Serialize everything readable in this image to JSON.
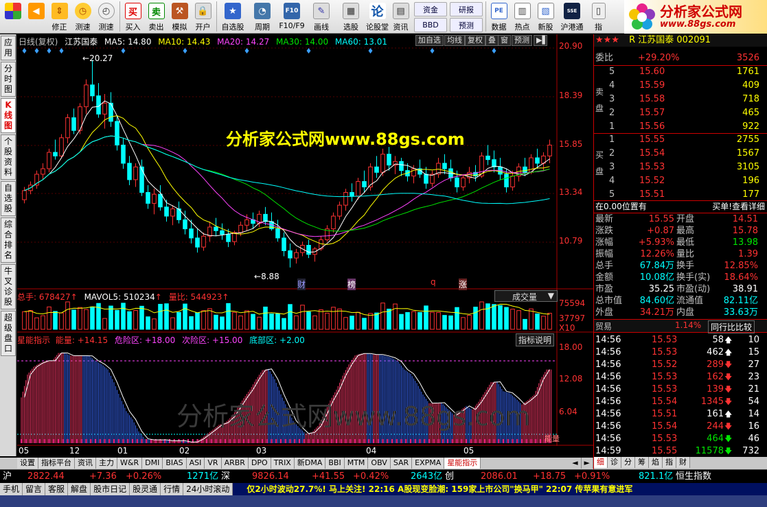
{
  "toolbar": {
    "buttons": [
      {
        "label": "",
        "icon": "window-icon"
      },
      {
        "label": "",
        "icon": "back-arrow-icon"
      },
      {
        "label": "修正",
        "icon": "up-down-icon"
      },
      {
        "label": "测速",
        "icon": "clock-icon"
      },
      {
        "label": "测速",
        "icon": "stopwatch-icon"
      },
      {
        "label": "买入",
        "icon": "buy-icon"
      },
      {
        "label": "卖出",
        "icon": "sell-icon"
      },
      {
        "label": "模拟",
        "icon": "hammer-icon"
      },
      {
        "label": "开户",
        "icon": "lock-icon"
      },
      {
        "label": "自选股",
        "icon": "star-icon"
      },
      {
        "label": "周期",
        "icon": "cycle-icon"
      },
      {
        "label": "F10/F9",
        "icon": "f10-icon"
      },
      {
        "label": "画线",
        "icon": "pen-icon"
      },
      {
        "label": "选股",
        "icon": "select-icon"
      },
      {
        "label": "论股堂",
        "icon": "forum-icon"
      },
      {
        "label": "资讯",
        "icon": "news-icon"
      }
    ],
    "small_buttons": [
      "资金",
      "研报",
      "BBD",
      "预测"
    ],
    "right_buttons": [
      {
        "label": "数据",
        "icon": "pe-icon"
      },
      {
        "label": "热点",
        "icon": "hotspot-icon"
      },
      {
        "label": "新股",
        "icon": "newstock-icon"
      },
      {
        "label": "沪港通",
        "icon": "sse-hkex-icon"
      },
      {
        "label": "指",
        "icon": "index-icon"
      }
    ],
    "logo_title": "分析家公式网",
    "logo_url": "www.88gs.com"
  },
  "left_tabs": [
    "应用",
    "分时图",
    "K线图",
    "个股资料",
    "自选股",
    "综合排名",
    "牛叉诊股",
    "超级盘口"
  ],
  "chart_header": {
    "period": "日线(复权)",
    "stock_name": "江苏国泰",
    "ma5": "MA5: 14.80",
    "ma10": "MA10: 14.43",
    "ma20": "MA20: 14.27",
    "ma30": "MA30: 14.00",
    "ma60": "MA60: 13.01",
    "buttons": [
      "加自选",
      "均线",
      "复权",
      "叠",
      "窗",
      "预测"
    ]
  },
  "watermark_top": "分析家公式网www.88gs.com",
  "watermark_bottom": "分析家公式网www.88gs.com",
  "chart_data": {
    "type": "candlestick",
    "price_axis_ticks": [
      "20.90",
      "18.39",
      "15.85",
      "13.34",
      "10.79"
    ],
    "price_range": [
      8.5,
      21.0
    ],
    "high_label": "20.27",
    "low_label": "8.88",
    "event_labels": [
      "财",
      "榜",
      "q",
      "涨"
    ],
    "volume": {
      "total": "总手: 678427",
      "mavol5": "MAVOL5: 510234",
      "volume_ratio": "量比: 544923",
      "axis_ticks": [
        "75594",
        "37797",
        "X10"
      ],
      "dropdown": "成交量"
    },
    "indicator": {
      "name": "星能指示",
      "energy": "能量: +14.15",
      "danger": "危险区: +18.00",
      "second": "次险区: +15.00",
      "bottom": "底部区: +2.00",
      "help": "指标说明",
      "axis_ticks": [
        "18.00",
        "12.08",
        "6.04"
      ],
      "end_label": "能量"
    },
    "time_axis": [
      "05",
      "12",
      "01",
      "02",
      "03",
      "04",
      "05"
    ],
    "candles": [
      [
        12.6,
        13.3,
        12.4,
        13.1
      ],
      [
        13.1,
        13.6,
        12.9,
        13.4
      ],
      [
        13.4,
        14.2,
        13.2,
        14.0
      ],
      [
        14.0,
        14.6,
        13.7,
        14.3
      ],
      [
        14.3,
        15.4,
        14.1,
        15.2
      ],
      [
        15.2,
        15.9,
        14.8,
        15.0
      ],
      [
        15.0,
        16.2,
        14.9,
        16.0
      ],
      [
        16.0,
        17.3,
        15.7,
        17.1
      ],
      [
        17.1,
        17.6,
        16.2,
        16.4
      ],
      [
        16.4,
        17.9,
        16.2,
        17.7
      ],
      [
        17.7,
        19.2,
        17.3,
        18.9
      ],
      [
        18.9,
        20.27,
        18.0,
        18.3
      ],
      [
        18.3,
        19.0,
        17.1,
        17.3
      ],
      [
        17.3,
        18.4,
        16.5,
        17.9
      ],
      [
        17.9,
        18.5,
        16.6,
        16.9
      ],
      [
        16.9,
        17.2,
        15.3,
        15.6
      ],
      [
        15.6,
        16.0,
        14.3,
        14.6
      ],
      [
        14.6,
        15.0,
        13.4,
        13.7
      ],
      [
        13.7,
        14.6,
        13.3,
        14.4
      ],
      [
        14.4,
        14.8,
        12.8,
        13.0
      ],
      [
        13.0,
        13.4,
        12.1,
        12.4
      ],
      [
        12.4,
        13.2,
        11.8,
        12.9
      ],
      [
        12.9,
        13.4,
        12.0,
        12.2
      ],
      [
        12.2,
        12.6,
        11.4,
        11.7
      ],
      [
        11.7,
        12.3,
        11.2,
        12.1
      ],
      [
        12.1,
        12.5,
        11.3,
        11.5
      ],
      [
        11.5,
        12.0,
        10.7,
        11.0
      ],
      [
        11.0,
        11.5,
        10.2,
        10.5
      ],
      [
        10.5,
        11.0,
        9.7,
        10.0
      ],
      [
        10.0,
        10.8,
        9.8,
        10.6
      ],
      [
        10.6,
        11.4,
        10.3,
        11.1
      ],
      [
        11.1,
        11.6,
        10.6,
        10.9
      ],
      [
        10.9,
        11.3,
        10.4,
        10.7
      ],
      [
        10.7,
        11.0,
        10.0,
        10.3
      ],
      [
        10.3,
        10.9,
        10.1,
        10.8
      ],
      [
        10.8,
        11.4,
        10.6,
        11.2
      ],
      [
        11.2,
        11.8,
        10.9,
        11.5
      ],
      [
        11.5,
        11.9,
        11.0,
        11.3
      ],
      [
        11.3,
        12.0,
        11.1,
        11.8
      ],
      [
        11.8,
        12.2,
        11.2,
        11.4
      ],
      [
        11.4,
        11.9,
        10.9,
        11.0
      ],
      [
        11.0,
        11.5,
        10.3,
        10.5
      ],
      [
        10.5,
        10.8,
        9.5,
        9.8
      ],
      [
        9.8,
        10.2,
        8.88,
        9.4
      ],
      [
        9.4,
        9.9,
        9.1,
        9.7
      ],
      [
        9.7,
        10.3,
        9.5,
        10.1
      ],
      [
        10.1,
        10.4,
        9.4,
        9.6
      ],
      [
        9.6,
        10.0,
        9.2,
        9.9
      ],
      [
        9.9,
        10.6,
        9.8,
        10.4
      ],
      [
        10.4,
        11.2,
        10.3,
        11.0
      ],
      [
        11.0,
        11.9,
        10.8,
        11.7
      ],
      [
        11.7,
        12.5,
        11.5,
        12.3
      ],
      [
        12.3,
        13.2,
        12.0,
        13.0
      ],
      [
        13.0,
        13.5,
        12.5,
        12.8
      ],
      [
        12.8,
        13.8,
        12.6,
        13.6
      ],
      [
        13.6,
        14.2,
        13.0,
        13.3
      ],
      [
        13.3,
        14.6,
        13.1,
        14.4
      ],
      [
        14.4,
        15.0,
        13.8,
        14.1
      ],
      [
        14.1,
        15.4,
        13.9,
        15.1
      ],
      [
        15.1,
        15.5,
        14.2,
        14.5
      ],
      [
        14.5,
        15.0,
        14.0,
        14.7
      ],
      [
        14.7,
        14.9,
        13.9,
        14.2
      ],
      [
        14.2,
        14.6,
        13.6,
        13.9
      ],
      [
        13.9,
        14.5,
        13.5,
        14.3
      ],
      [
        14.3,
        14.8,
        13.8,
        14.0
      ],
      [
        14.0,
        14.4,
        13.2,
        13.5
      ],
      [
        13.5,
        14.2,
        13.3,
        14.0
      ],
      [
        14.0,
        14.9,
        13.8,
        14.6
      ],
      [
        14.6,
        15.1,
        14.0,
        14.3
      ],
      [
        14.3,
        14.8,
        13.6,
        13.8
      ],
      [
        13.8,
        14.2,
        13.0,
        13.3
      ],
      [
        13.3,
        14.0,
        13.1,
        13.8
      ],
      [
        13.8,
        14.4,
        13.5,
        14.1
      ],
      [
        14.1,
        14.5,
        13.6,
        13.9
      ],
      [
        13.9,
        15.2,
        13.8,
        15.0
      ],
      [
        15.0,
        15.6,
        14.5,
        14.8
      ],
      [
        14.8,
        15.3,
        14.1,
        14.4
      ],
      [
        14.4,
        14.9,
        13.7,
        14.0
      ],
      [
        14.0,
        14.3,
        13.0,
        13.3
      ],
      [
        13.3,
        14.2,
        13.1,
        13.9
      ],
      [
        13.9,
        14.6,
        13.6,
        14.4
      ],
      [
        14.4,
        14.9,
        13.9,
        14.1
      ],
      [
        14.1,
        15.1,
        14.0,
        14.9
      ],
      [
        14.9,
        15.4,
        14.3,
        14.6
      ],
      [
        14.6,
        15.2,
        14.2,
        15.0
      ],
      [
        15.0,
        15.9,
        14.6,
        15.6
      ]
    ]
  },
  "quote": {
    "stars": "★★★",
    "title": "R 江苏国泰 002091",
    "weibi_label": "委比",
    "weibi": "+29.20%",
    "weicha": "3526",
    "sell_label": "卖盘",
    "buy_label": "买盘",
    "asks": [
      [
        "5",
        "15.60",
        "1761"
      ],
      [
        "4",
        "15.59",
        "409"
      ],
      [
        "3",
        "15.58",
        "718"
      ],
      [
        "2",
        "15.57",
        "465"
      ],
      [
        "1",
        "15.56",
        "922"
      ]
    ],
    "bids": [
      [
        "1",
        "15.55",
        "2755"
      ],
      [
        "2",
        "15.54",
        "1567"
      ],
      [
        "3",
        "15.53",
        "3105"
      ],
      [
        "4",
        "15.52",
        "196"
      ],
      [
        "5",
        "15.51",
        "177"
      ]
    ],
    "position_label": "在0.00位置有",
    "detail_label": "买单!查看详细",
    "stats": [
      [
        "最新",
        "15.55",
        "开盘",
        "14.51"
      ],
      [
        "涨跌",
        "+0.87",
        "最高",
        "15.78"
      ],
      [
        "涨幅",
        "+5.93%",
        "最低",
        "13.98"
      ],
      [
        "振幅",
        "12.26%",
        "量比",
        "1.39"
      ],
      [
        "总手",
        "67.84万",
        "换手",
        "12.85%"
      ],
      [
        "金额",
        "10.08亿",
        "换手(实)",
        "18.64%"
      ],
      [
        "市盈",
        "35.25",
        "市盈(动)",
        "38.91"
      ],
      [
        "总市值",
        "84.60亿",
        "流通值",
        "82.11亿"
      ],
      [
        "外盘",
        "34.21万",
        "内盘",
        "33.63万"
      ]
    ],
    "trade_label": "贸易",
    "trade_pct": "1.14%",
    "compare_label": "同行比比较",
    "ticks": [
      [
        "14:56",
        "15.53",
        "58",
        "up",
        "10"
      ],
      [
        "14:56",
        "15.53",
        "462",
        "up",
        "15"
      ],
      [
        "14:56",
        "15.52",
        "289",
        "down",
        "27"
      ],
      [
        "14:56",
        "15.53",
        "162",
        "down",
        "23"
      ],
      [
        "14:56",
        "15.53",
        "139",
        "down",
        "21"
      ],
      [
        "14:56",
        "15.54",
        "1345",
        "down",
        "54"
      ],
      [
        "14:56",
        "15.51",
        "161",
        "up",
        "14"
      ],
      [
        "14:56",
        "15.54",
        "244",
        "down",
        "16"
      ],
      [
        "14:56",
        "15.53",
        "464",
        "down",
        "46"
      ],
      [
        "14:59",
        "15.55",
        "11578",
        "down",
        "732"
      ]
    ],
    "tabs": [
      "细",
      "诊",
      "分",
      "筹",
      "焰",
      "指",
      "财"
    ]
  },
  "bottom_tabs": [
    "设置",
    "指标平台",
    "资讯",
    "主力",
    "W&R",
    "DMI",
    "BIAS",
    "ASI",
    "VR",
    "ARBR",
    "DPO",
    "TRIX",
    "新DMA",
    "BBI",
    "MTM",
    "OBV",
    "SAR",
    "EXPMA",
    "星能指示"
  ],
  "index_bar": {
    "sh_label": "沪",
    "sh_value": "2822.44",
    "sh_change": "+7.36",
    "sh_pct": "+0.26%",
    "sh_amount": "1271亿",
    "sz_label": "深",
    "sz_value": "9826.14",
    "sz_change": "+41.55",
    "sz_pct": "+0.42%",
    "sz_amount": "2643亿",
    "cy_label": "创",
    "cy_value": "2086.01",
    "cy_change": "+18.75",
    "cy_pct": "+0.91%",
    "cy_amount": "821.1亿",
    "hs_label": "恒生指数"
  },
  "status_bar": {
    "items": [
      "手机",
      "留言",
      "客服",
      "解盘",
      "股市日记",
      "股灵通",
      "行情",
      "24小时滚动"
    ],
    "ticker": "仅2小时波动27.7%! 马上关注!      22:16 A股现变脸潮: 159家上市公司\"换马甲\"      22:07 传苹果有意进军"
  }
}
